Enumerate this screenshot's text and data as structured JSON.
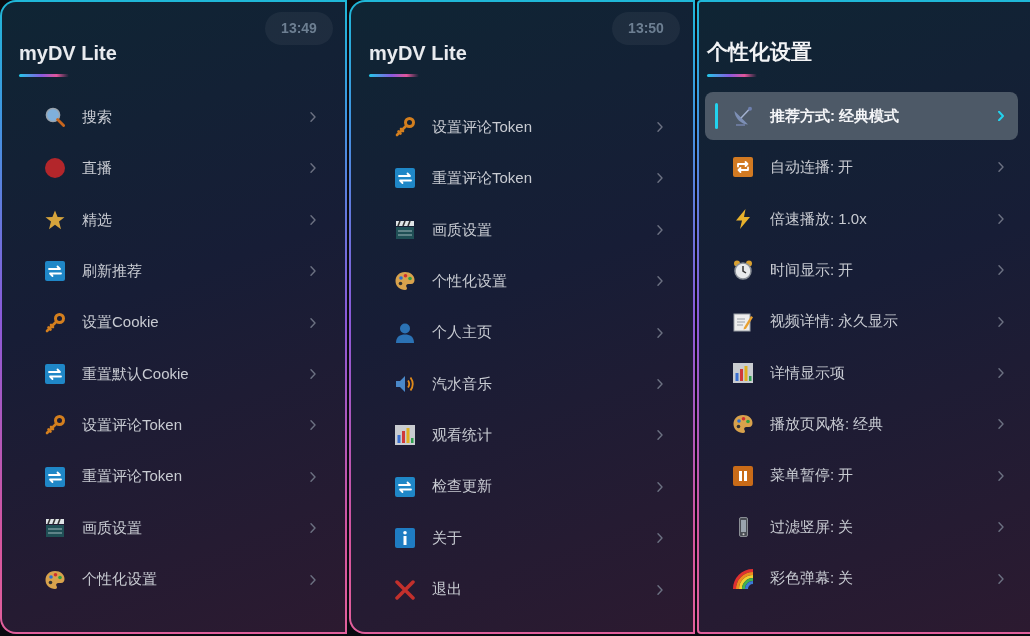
{
  "panels": [
    {
      "clock": "13:49",
      "title": "myDV Lite",
      "items": [
        {
          "kind": "search",
          "label": "搜索",
          "selected": false
        },
        {
          "kind": "dot",
          "label": "直播",
          "selected": false
        },
        {
          "kind": "star",
          "label": "精选",
          "selected": false
        },
        {
          "kind": "arrows",
          "label": "刷新推荐",
          "selected": false
        },
        {
          "kind": "key",
          "label": "设置Cookie",
          "selected": false
        },
        {
          "kind": "arrows",
          "label": "重置默认Cookie",
          "selected": false
        },
        {
          "kind": "key",
          "label": "设置评论Token",
          "selected": false
        },
        {
          "kind": "arrows",
          "label": "重置评论Token",
          "selected": false
        },
        {
          "kind": "clapperboard",
          "label": "画质设置",
          "selected": false
        },
        {
          "kind": "palette",
          "label": "个性化设置",
          "selected": false
        }
      ]
    },
    {
      "clock": "13:50",
      "title": "myDV Lite",
      "items": [
        {
          "kind": "key",
          "label": "设置评论Token",
          "selected": false
        },
        {
          "kind": "arrows",
          "label": "重置评论Token",
          "selected": false
        },
        {
          "kind": "clapperboard",
          "label": "画质设置",
          "selected": false
        },
        {
          "kind": "palette",
          "label": "个性化设置",
          "selected": false
        },
        {
          "kind": "person",
          "label": "个人主页",
          "selected": false
        },
        {
          "kind": "speaker",
          "label": "汽水音乐",
          "selected": false
        },
        {
          "kind": "chart",
          "label": "观看统计",
          "selected": false
        },
        {
          "kind": "arrows",
          "label": "检查更新",
          "selected": false
        },
        {
          "kind": "info",
          "label": "关于",
          "selected": false
        },
        {
          "kind": "cross",
          "label": "退出",
          "selected": false
        }
      ]
    },
    {
      "title": "个性化设置",
      "items": [
        {
          "kind": "dish",
          "label": "推荐方式: 经典模式",
          "selected": true
        },
        {
          "kind": "repeat",
          "label": "自动连播: 开",
          "selected": false
        },
        {
          "kind": "lightning",
          "label": "倍速播放: 1.0x",
          "selected": false
        },
        {
          "kind": "alarm",
          "label": "时间显示: 开",
          "selected": false
        },
        {
          "kind": "memo",
          "label": "视频详情: 永久显示",
          "selected": false
        },
        {
          "kind": "chart",
          "label": "详情显示项",
          "selected": false
        },
        {
          "kind": "palette",
          "label": "播放页风格: 经典",
          "selected": false
        },
        {
          "kind": "pause",
          "label": "菜单暂停: 开",
          "selected": false
        },
        {
          "kind": "phone",
          "label": "过滤竖屏: 关",
          "selected": false
        },
        {
          "kind": "rainbow",
          "label": "彩色弹幕: 关",
          "selected": false
        }
      ]
    }
  ]
}
